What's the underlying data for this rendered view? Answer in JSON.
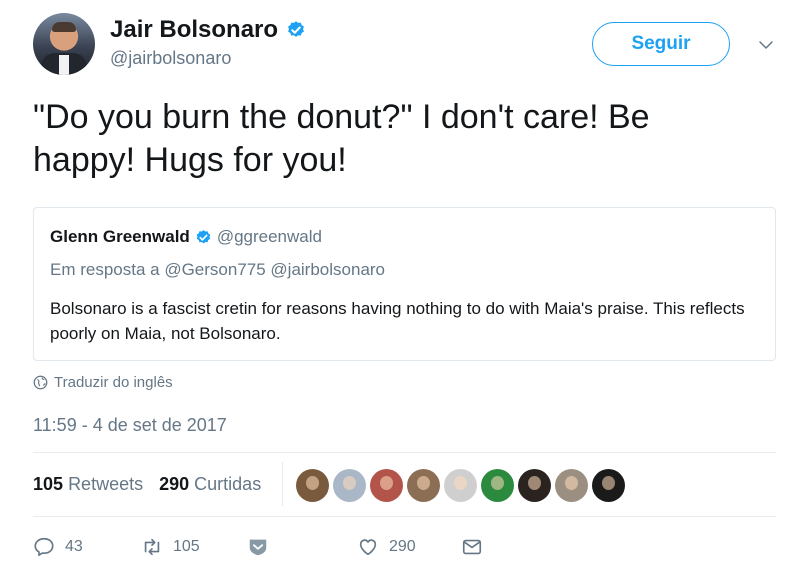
{
  "author": {
    "name": "Jair Bolsonaro",
    "handle": "@jairbolsonaro",
    "verified": true
  },
  "follow_button": {
    "label": "Seguir"
  },
  "tweet": {
    "text": "\"Do you burn the donut?\" I don't care! Be happy! Hugs for you!"
  },
  "quoted_tweet": {
    "name": "Glenn Greenwald",
    "handle": "@ggreenwald",
    "verified": true,
    "reply_to": "Em resposta a @Gerson775 @jairbolsonaro",
    "text": "Bolsonaro is a fascist cretin for reasons having nothing to do with Maia's praise. This reflects poorly on Maia, not Bolsonaro."
  },
  "translate_link": "Traduzir do inglês",
  "timestamp": "11:59 - 4 de set de 2017",
  "stats": {
    "retweets_count": "105",
    "retweets_label": "Retweets",
    "likes_count": "290",
    "likes_label": "Curtidas"
  },
  "likers": [
    {
      "color": "#7a5a3c"
    },
    {
      "color": "#a9b7c6"
    },
    {
      "color": "#b2544a"
    },
    {
      "color": "#8c6e54"
    },
    {
      "color": "#cfcfcf"
    },
    {
      "color": "#2b8a3e"
    },
    {
      "color": "#2a2320"
    },
    {
      "color": "#9a8f80"
    },
    {
      "color": "#1a1a1a"
    }
  ],
  "actions": {
    "reply_count": "43",
    "retweet_count": "105",
    "like_count": "290"
  },
  "colors": {
    "accent": "#1da1f2",
    "secondary_text": "#657786",
    "primary_text": "#14171a",
    "border": "#e1e8ed"
  }
}
